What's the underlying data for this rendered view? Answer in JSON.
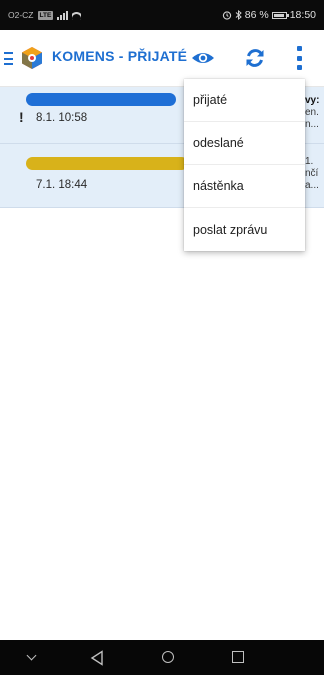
{
  "status_bar": {
    "carrier": "O2-CZ",
    "network_badge": "LTE",
    "alarm_icon": "alarm-icon",
    "bluetooth_icon": "bluetooth-icon",
    "battery_percent": "86 %",
    "time": "18:50"
  },
  "app_bar": {
    "title": "KOMENS - PŘIJATÉ",
    "icons": [
      "hamburger-icon",
      "app-logo",
      "eye-icon",
      "refresh-icon",
      "overflow-menu-icon"
    ]
  },
  "messages": [
    {
      "important": "!",
      "date": "8.1. 10:58",
      "snippet_line1": "vy:",
      "snippet_line2": "en.",
      "snippet_line3": "n..."
    },
    {
      "important": "",
      "date": "7.1. 18:44",
      "snippet_line1": "1.",
      "snippet_line2": "nčí",
      "snippet_line3": "a..."
    }
  ],
  "menu": {
    "items": [
      "přijaté",
      "odeslané",
      "nástěnka",
      "poslat zprávu"
    ]
  },
  "nav_bar": {
    "icons": [
      "hide-keyboard-icon",
      "back-icon",
      "home-icon",
      "recents-icon"
    ]
  },
  "colors": {
    "accent": "#1e6fd1",
    "row_background": "#e3eef9",
    "redaction_blue": "#1f6fd6",
    "redaction_yellow": "#d8b21a"
  }
}
